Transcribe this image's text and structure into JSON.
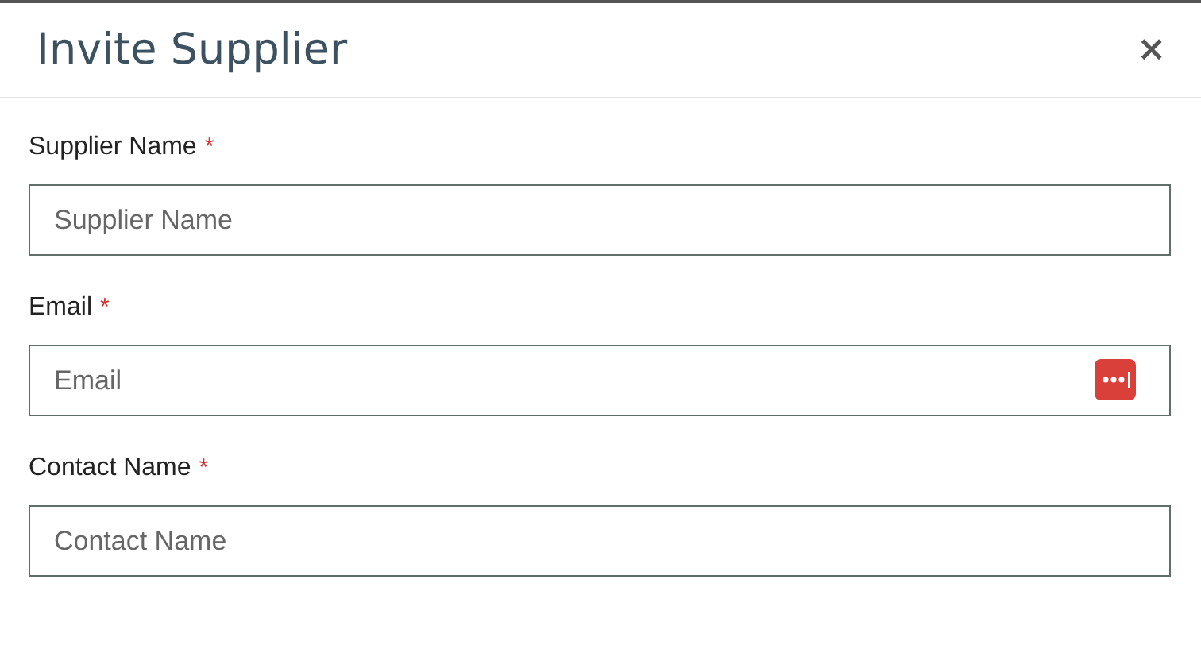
{
  "dialog": {
    "title": "Invite Supplier",
    "close": "×"
  },
  "fields": [
    {
      "label": "Supplier Name",
      "required_mark": "*",
      "placeholder": "Supplier Name",
      "kind": "text"
    },
    {
      "label": "Email",
      "required_mark": "*",
      "placeholder": "Email",
      "kind": "password-manager"
    },
    {
      "label": "Contact Name",
      "required_mark": "*",
      "placeholder": "Contact Name",
      "kind": "text"
    }
  ]
}
